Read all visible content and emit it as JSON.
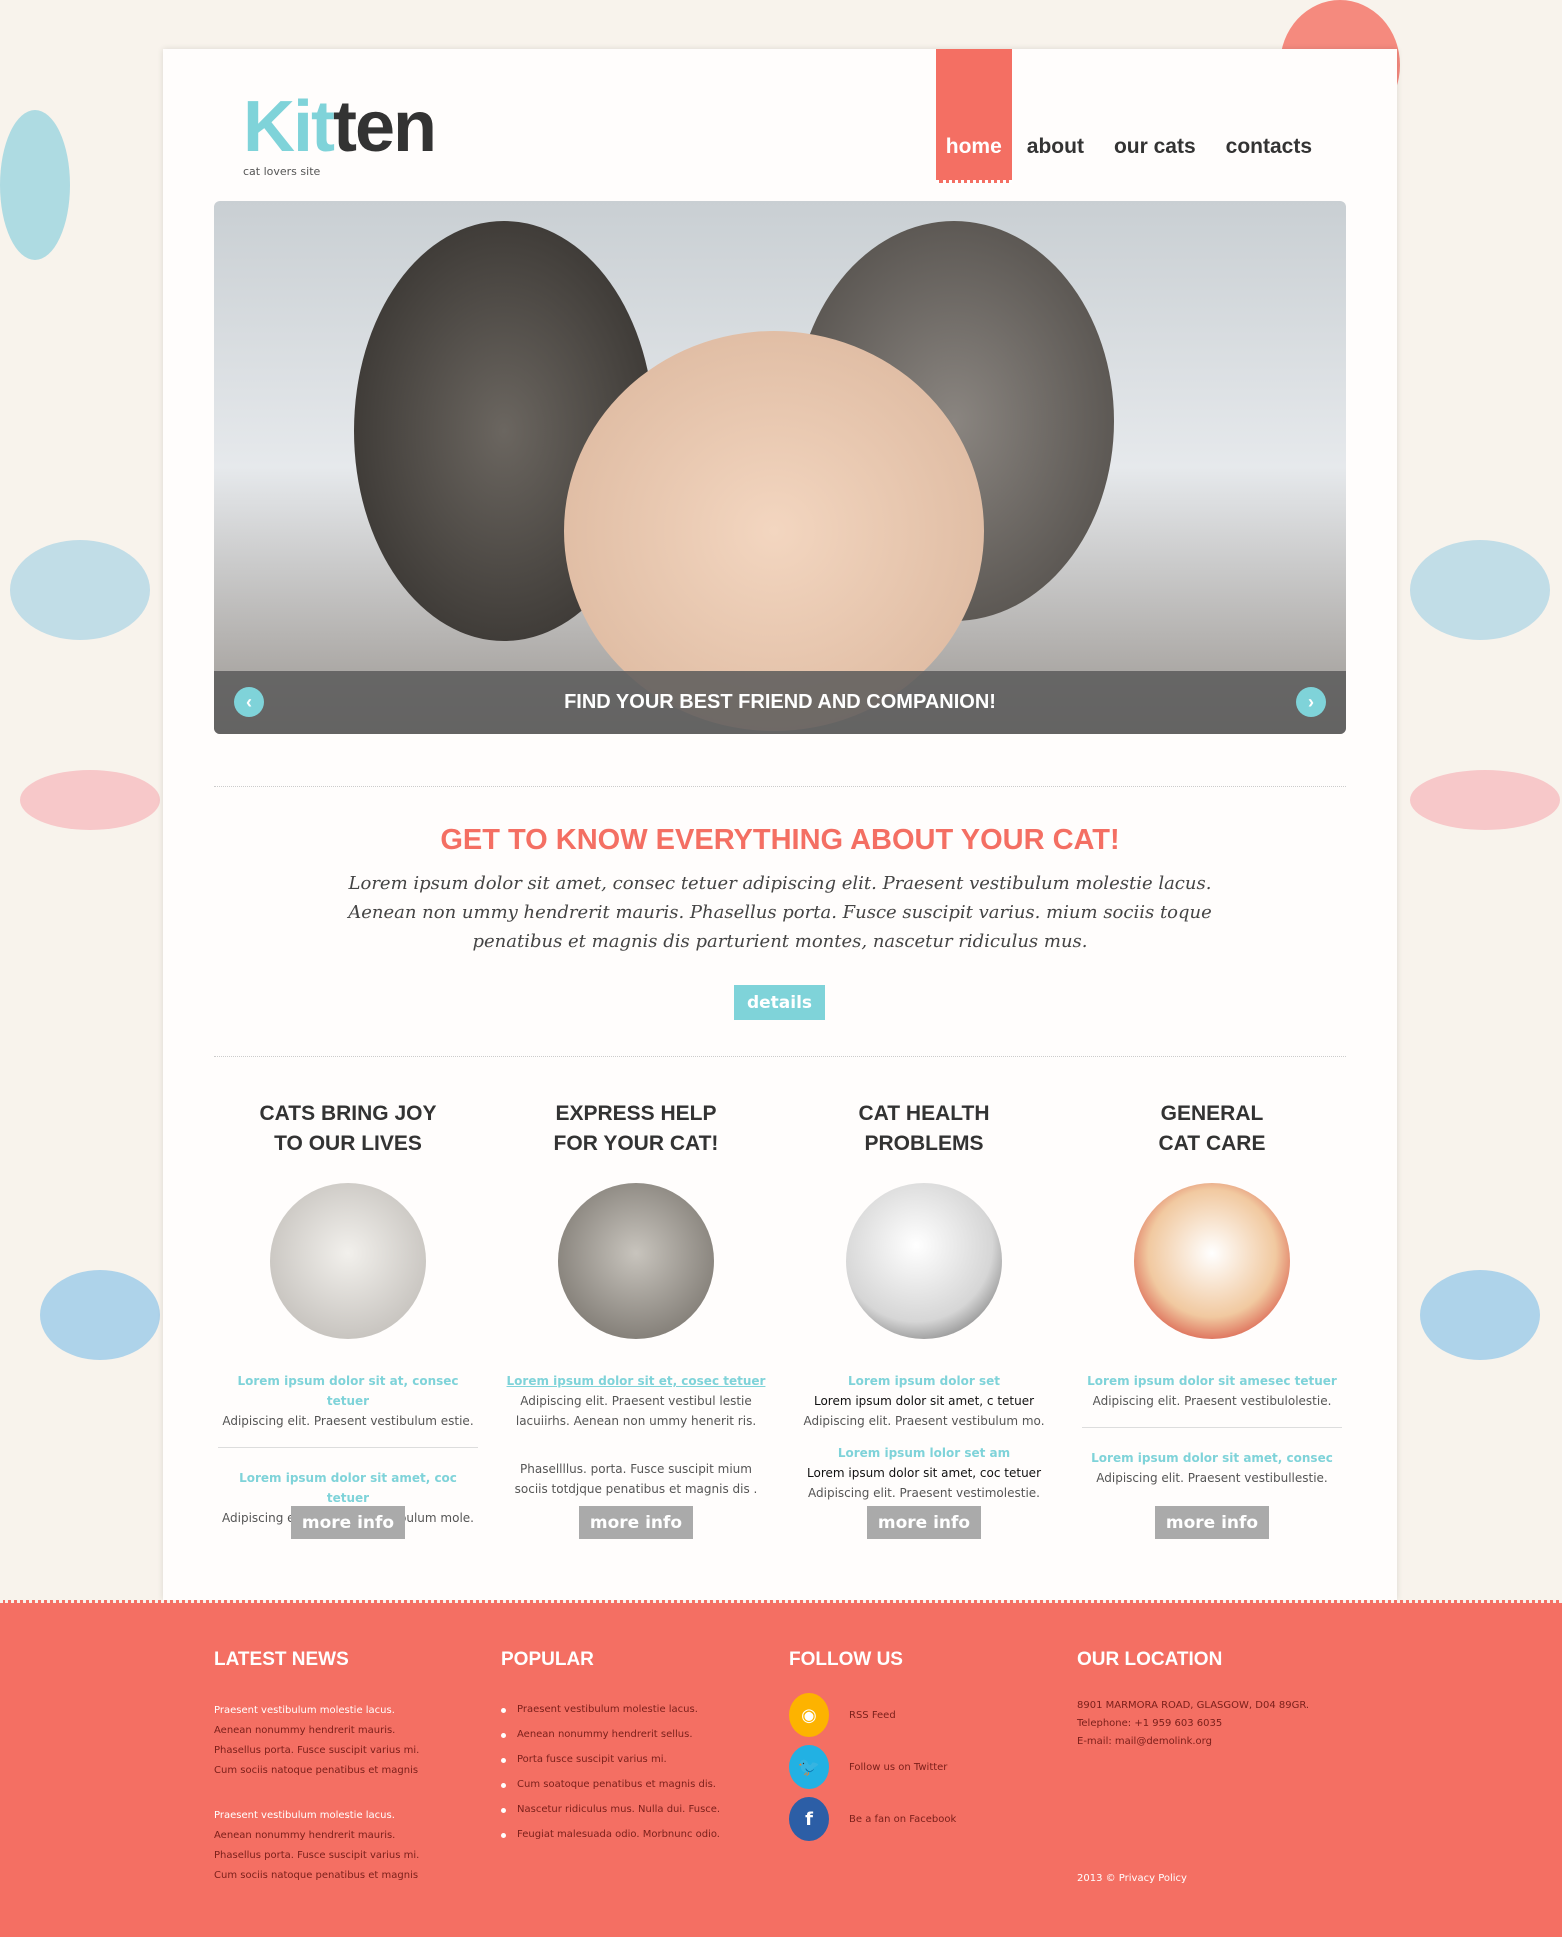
{
  "brand": {
    "logo_part1": "Kit",
    "logo_part2": "ten",
    "tagline": "cat lovers site"
  },
  "nav": [
    {
      "label": "home",
      "active": true
    },
    {
      "label": "about"
    },
    {
      "label": "our cats"
    },
    {
      "label": "contacts"
    }
  ],
  "slider": {
    "caption": "FIND YOUR BEST FRIEND AND COMPANION!",
    "prev_icon": "chevron-left-icon",
    "next_icon": "chevron-right-icon"
  },
  "intro": {
    "title": "GET TO KNOW EVERYTHING ABOUT YOUR CAT!",
    "text": "Lorem ipsum dolor sit amet, consec tetuer adipiscing elit. Praesent vestibulum molestie lacus. Aenean non ummy hendrerit mauris. Phasellus porta. Fusce suscipit varius. mium sociis toque penatibus et magnis dis parturient montes, nascetur ridiculus mus.",
    "button": "details"
  },
  "columns": [
    {
      "title1": "CATS BRING JOY",
      "title2": "TO OUR LIVES",
      "blocks": [
        {
          "h": "Lorem ipsum dolor sit at, consec tetuer",
          "t": "Adipiscing elit. Praesent vestibulum estie."
        },
        {
          "h": "Lorem ipsum dolor sit amet, coc tetuer",
          "t": "Adipiscing elit. Praesent vestibulum mole."
        }
      ],
      "button": "more info"
    },
    {
      "title1": "EXPRESS HELP",
      "title2": "FOR YOUR CAT!",
      "blocks": [
        {
          "h": "Lorem ipsum dolor sit et, cosec tetuer",
          "t": "Adipiscing elit. Praesent vestibul lestie lacuiirhs. Aenean non ummy henerit ris."
        },
        {
          "t": "Phasellllus. porta. Fusce suscipit  mium sociis totdjque penatibus et magnis dis ."
        }
      ],
      "button": "more info"
    },
    {
      "title1": "CAT HEALTH",
      "title2": "PROBLEMS",
      "blocks": [
        {
          "h": "Lorem ipsum dolor set",
          "b": "Lorem ipsum dolor sit amet, c tetuer",
          "t": "Adipiscing elit. Praesent vestibulum mo."
        },
        {
          "h": "Lorem ipsum lolor set am",
          "b": "Lorem ipsum dolor sit amet, coc tetuer",
          "t": "Adipiscing elit. Praesent vestimolestie."
        }
      ],
      "button": "more info"
    },
    {
      "title1": "GENERAL",
      "title2": "CAT CARE",
      "blocks": [
        {
          "h": "Lorem ipsum dolor sit amesec tetuer",
          "t": "Adipiscing elit. Praesent vestibulolestie."
        },
        {
          "h": "Lorem ipsum dolor sit amet, consec",
          "t": "Adipiscing elit. Praesent vestibullestie."
        }
      ],
      "button": "more info"
    }
  ],
  "footer": {
    "news": {
      "title": "LATEST NEWS",
      "items": [
        [
          "Praesent vestibulum molestie lacus.",
          "Aenean nonummy hendrerit mauris.",
          "Phasellus porta. Fusce suscipit varius mi.",
          "Cum sociis natoque penatibus et magnis"
        ],
        [
          "Praesent vestibulum molestie lacus.",
          "Aenean nonummy hendrerit mauris.",
          "Phasellus porta. Fusce suscipit varius mi.",
          "Cum sociis natoque penatibus et magnis"
        ]
      ]
    },
    "popular": {
      "title": "POPULAR",
      "items": [
        "Praesent vestibulum molestie lacus.",
        "Aenean nonummy hendrerit sellus.",
        "Porta fusce suscipit varius mi.",
        "Cum soatoque penatibus et magnis dis.",
        "Nascetur ridiculus mus. Nulla dui. Fusce.",
        "Feugiat malesuada odio. Morbnunc odio."
      ]
    },
    "follow": {
      "title": "FOLLOW US",
      "items": [
        {
          "label": "RSS Feed",
          "icon": "rss-icon",
          "color": "#fdb300"
        },
        {
          "label": "Follow us on Twitter",
          "icon": "twitter-icon",
          "color": "#22b1e3"
        },
        {
          "label": "Be a fan on Facebook",
          "icon": "facebook-icon",
          "color": "#2c5ea6"
        }
      ]
    },
    "location": {
      "title": "OUR LOCATION",
      "address": "8901 MARMORA ROAD, GLASGOW, D04 89GR.",
      "phone": "Telephone: +1 959 603 6035",
      "email": "E-mail: mail@demolink.org"
    },
    "copyright": "2013 © Privacy Policy"
  },
  "colors": {
    "accent": "#f46f63",
    "teal": "#7fd3d9",
    "background": "#f8f3ec"
  }
}
